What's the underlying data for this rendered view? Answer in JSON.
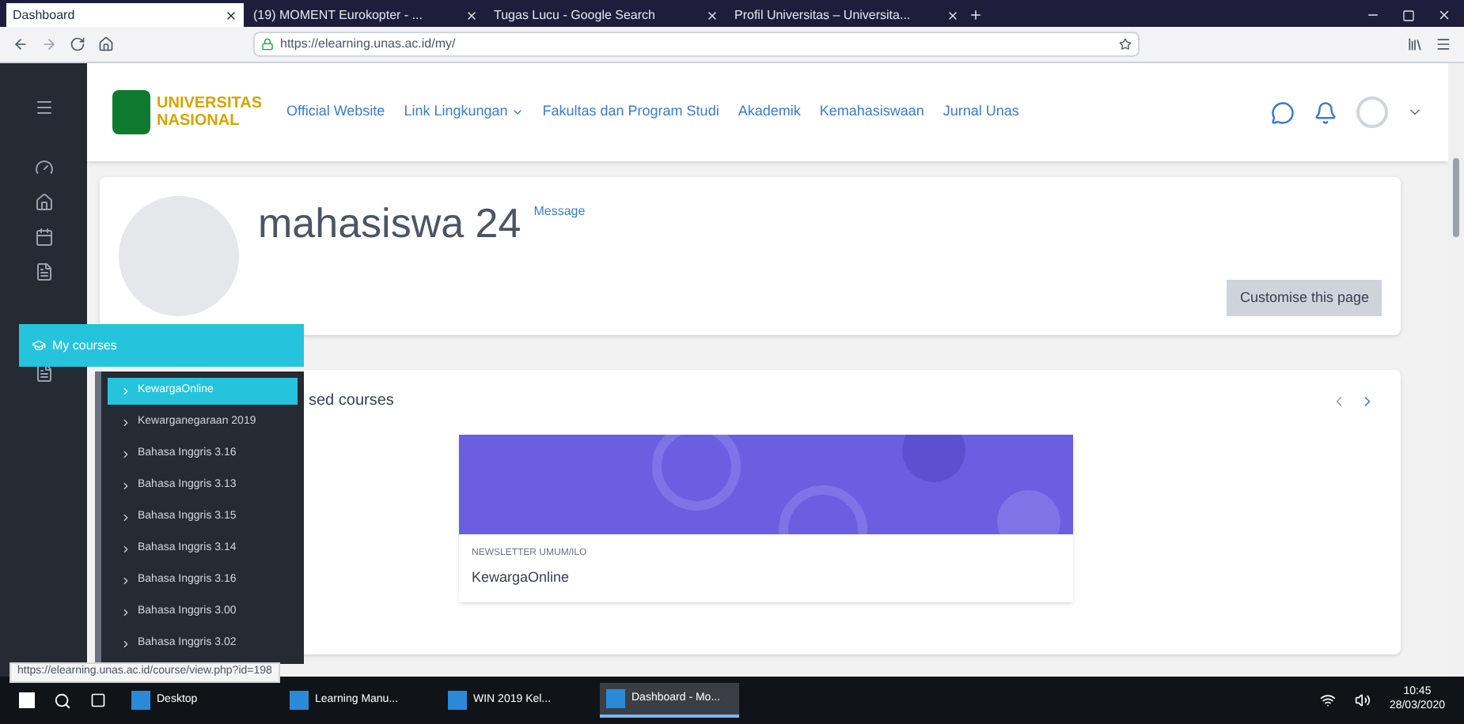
{
  "browser": {
    "tabs": [
      {
        "title": "Dashboard",
        "selected": true
      },
      {
        "title": "(19) MOMENT Eurokopter - ...",
        "selected": false
      },
      {
        "title": "Tugas Lucu - Google Search",
        "selected": false
      },
      {
        "title": "Profil Universitas – Universita...",
        "selected": false
      }
    ],
    "url": "https://elearning.unas.ac.id/my/"
  },
  "navbar": {
    "logo_text": "UNIVERSITAS NASIONAL",
    "links": [
      {
        "label": "Official Website",
        "dropdown": false
      },
      {
        "label": "Link Lingkungan",
        "dropdown": true
      },
      {
        "label": "Fakultas dan Program Studi",
        "dropdown": false
      },
      {
        "label": "Akademik",
        "dropdown": false
      },
      {
        "label": "Kemahasiswaan",
        "dropdown": false
      },
      {
        "label": "Jurnal Unas",
        "dropdown": false
      }
    ]
  },
  "profile": {
    "name": "mahasiswa 24",
    "message": "Message",
    "customise": "Customise this page"
  },
  "recent": {
    "title": "sed courses",
    "course": {
      "category": "NEWSLETTER UMUM/ILO",
      "name": "KewargaOnline"
    }
  },
  "flyout": {
    "header": "My courses",
    "items": [
      {
        "label": "KewargaOnline",
        "selected": true
      },
      {
        "label": "Kewarganegaraan 2019",
        "selected": false
      },
      {
        "label": "Bahasa Inggris 3.16",
        "selected": false
      },
      {
        "label": "Bahasa Inggris 3.13",
        "selected": false
      },
      {
        "label": "Bahasa Inggris 3.15",
        "selected": false
      },
      {
        "label": "Bahasa Inggris 3.14",
        "selected": false
      },
      {
        "label": "Bahasa Inggris 3.16",
        "selected": false
      },
      {
        "label": "Bahasa Inggris 3.00",
        "selected": false
      },
      {
        "label": "Bahasa Inggris 3.02",
        "selected": false
      }
    ]
  },
  "status_url": "https://elearning.unas.ac.id/course/view.php?id=198",
  "taskbar": {
    "apps": [
      {
        "label": "Desktop",
        "active": false
      },
      {
        "label": "Learning Manu...",
        "active": false
      },
      {
        "label": "WIN 2019 Kel...",
        "active": false
      },
      {
        "label": "Dashboard - Mo...",
        "active": true
      }
    ],
    "time": "10:45",
    "date": "28/03/2020"
  }
}
